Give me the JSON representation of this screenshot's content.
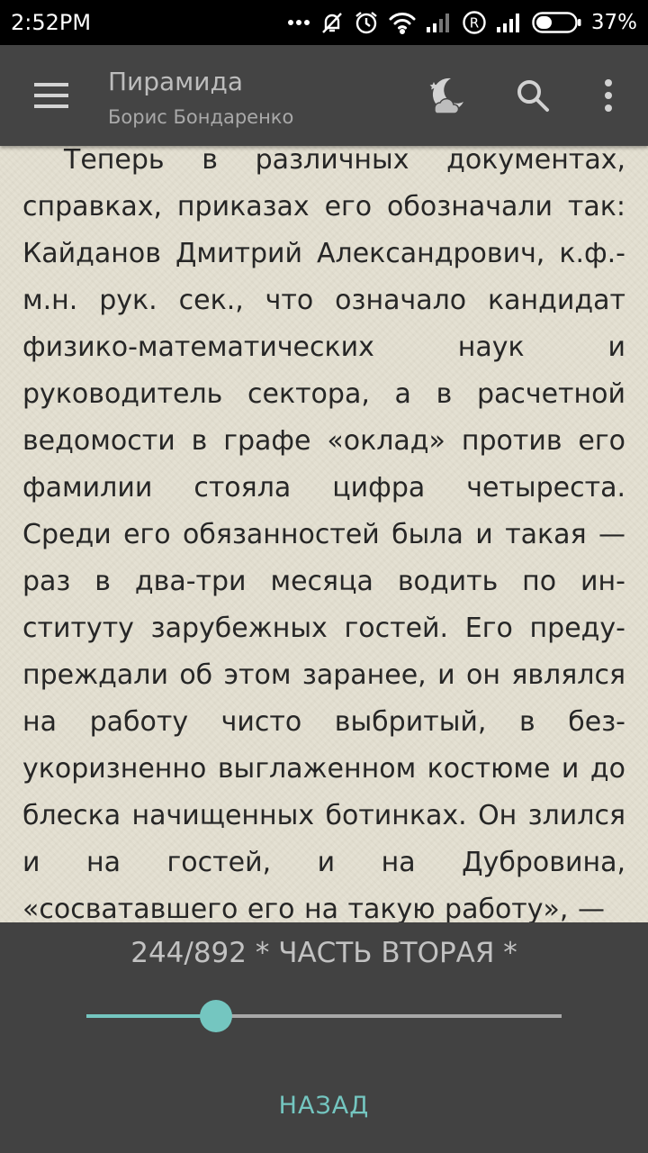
{
  "status_bar": {
    "time": "2:52PM",
    "battery": "37%",
    "icons": [
      "more-dots-icon",
      "muted-bell-icon",
      "alarm-icon",
      "wifi-icon",
      "signal-icon",
      "roaming-icon",
      "signal-2-icon",
      "battery-icon"
    ],
    "battery_level": 0.37
  },
  "app_bar": {
    "title": "Пирамида",
    "subtitle": "Борис Бондаренко",
    "icons": [
      "menu-icon",
      "night-mode-icon",
      "search-icon",
      "more-vert-icon"
    ]
  },
  "content": {
    "text": "Теперь в различных документах, справках, приказах его обозначали так: Кайданов Дмитрий Александро­вич, к.ф.-м.н. рук. сек., что означало кандидат физико-математических на­ук и руководитель сектора, а в расчет­ной ведомости в графе «оклад» против его фамилии стояла цифра четыреста. Среди его обязанностей была и такая — раз в два-три месяца водить по ин­ституту зарубежных гостей. Его преду­преждали об этом заранее, и он являл­ся на работу чисто выбритый, в без­укоризненно выглаженном костюме и до блеска начищенных ботинках. Он злился и на гостей, и на Дубровина, «сосватавшего его на такую работу», —"
  },
  "bottom_panel": {
    "progress_label": "244/892  * ЧАСТЬ ВТОРАЯ *",
    "current_page": 244,
    "total_pages": 892,
    "slider_fraction": 0.2727,
    "back_label": "НАЗАД"
  },
  "colors": {
    "accent": "#74c6c0",
    "app_bar": "#444444",
    "paper": "#e4e0d1",
    "text": "#262626"
  }
}
